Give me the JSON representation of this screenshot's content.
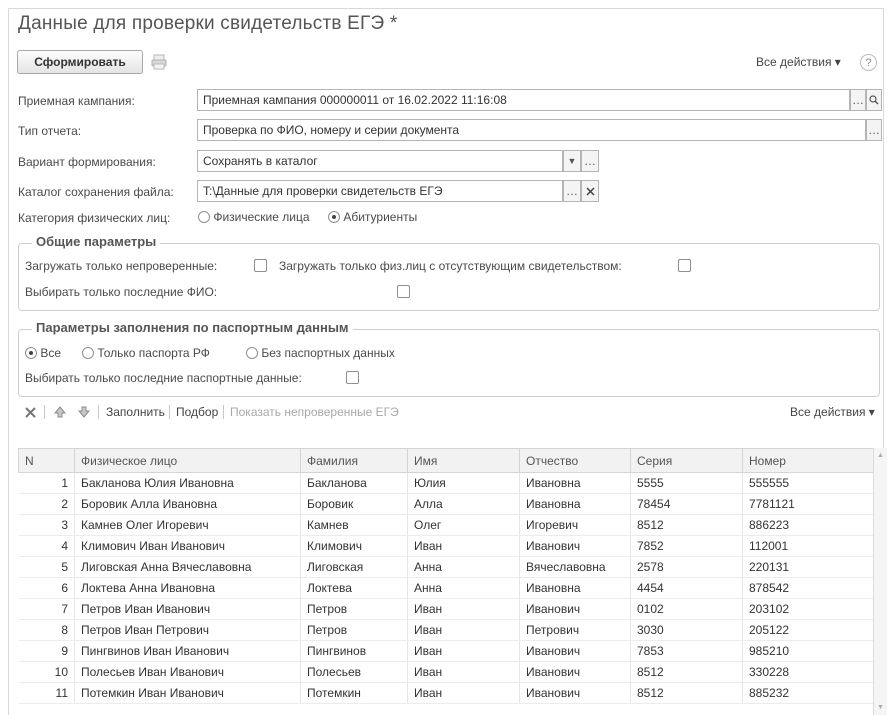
{
  "title": "Данные для проверки свидетельств ЕГЭ *",
  "toolbar": {
    "generate_label": "Сформировать",
    "all_actions": "Все действия ▾",
    "help": "?"
  },
  "form": {
    "campaign_label": "Приемная кампания:",
    "campaign_value": "Приемная кампания 000000011 от 16.02.2022 11:16:08",
    "report_type_label": "Тип отчета:",
    "report_type_value": "Проверка по ФИО, номеру и серии документа",
    "variant_label": "Вариант формирования:",
    "variant_value": "Сохранять в каталог",
    "catalog_label": "Каталог сохранения файла:",
    "catalog_value": "T:\\Данные для проверки свидетельств ЕГЭ",
    "category_label": "Категория физических лиц:",
    "category_opt1": "Физические лица",
    "category_opt2": "Абитуриенты",
    "category_selected": "Абитуриенты"
  },
  "general": {
    "title": "Общие параметры",
    "only_unchecked": "Загружать только непроверенные:",
    "only_missing_cert": "Загружать только физ.лиц с отсутствующим свидетельством:",
    "only_last_fio": "Выбирать только последние ФИО:"
  },
  "passport": {
    "title": "Параметры заполнения по паспортным данным",
    "opt_all": "Все",
    "opt_rf": "Только паспорта РФ",
    "opt_none": "Без паспортных данных",
    "selected": "Все",
    "only_last": "Выбирать только последние паспортные данные:"
  },
  "table_toolbar": {
    "fill": "Заполнить",
    "pick": "Подбор",
    "show_unchecked": "Показать непроверенные ЕГЭ",
    "all_actions": "Все действия ▾"
  },
  "table": {
    "columns": [
      "N",
      "Физическое лицо",
      "Фамилия",
      "Имя",
      "Отчество",
      "Серия",
      "Номер"
    ],
    "rows": [
      [
        "1",
        "Бакланова Юлия Ивановна",
        "Бакланова",
        "Юлия",
        "Ивановна",
        "5555",
        "555555"
      ],
      [
        "2",
        "Боровик Алла Ивановна",
        "Боровик",
        "Алла",
        "Ивановна",
        "78454",
        "7781121"
      ],
      [
        "3",
        "Камнев Олег Игоревич",
        "Камнев",
        "Олег",
        "Игоревич",
        "8512",
        "886223"
      ],
      [
        "4",
        "Климович Иван Иванович",
        "Климович",
        "Иван",
        "Иванович",
        "7852",
        "112001"
      ],
      [
        "5",
        "Лиговская Анна Вячеславовна",
        "Лиговская",
        "Анна",
        "Вячеславовна",
        "2578",
        "220131"
      ],
      [
        "6",
        "Локтева Анна Ивановна",
        "Локтева",
        "Анна",
        "Ивановна",
        "4454",
        "878542"
      ],
      [
        "7",
        "Петров Иван Иванович",
        "Петров",
        "Иван",
        "Иванович",
        "0102",
        "203102"
      ],
      [
        "8",
        "Петров Иван Петрович",
        "Петров",
        "Иван",
        "Петрович",
        "3030",
        "205122"
      ],
      [
        "9",
        "Пингвинов Иван Иванович",
        "Пингвинов",
        "Иван",
        "Иванович",
        "7853",
        "985210"
      ],
      [
        "10",
        "Полесьев Иван Иванович",
        "Полесьев",
        "Иван",
        "Иванович",
        "8512",
        "330228"
      ],
      [
        "11",
        "Потемкин Иван Иванович",
        "Потемкин",
        "Иван",
        "Иванович",
        "8512",
        "885232"
      ]
    ]
  }
}
